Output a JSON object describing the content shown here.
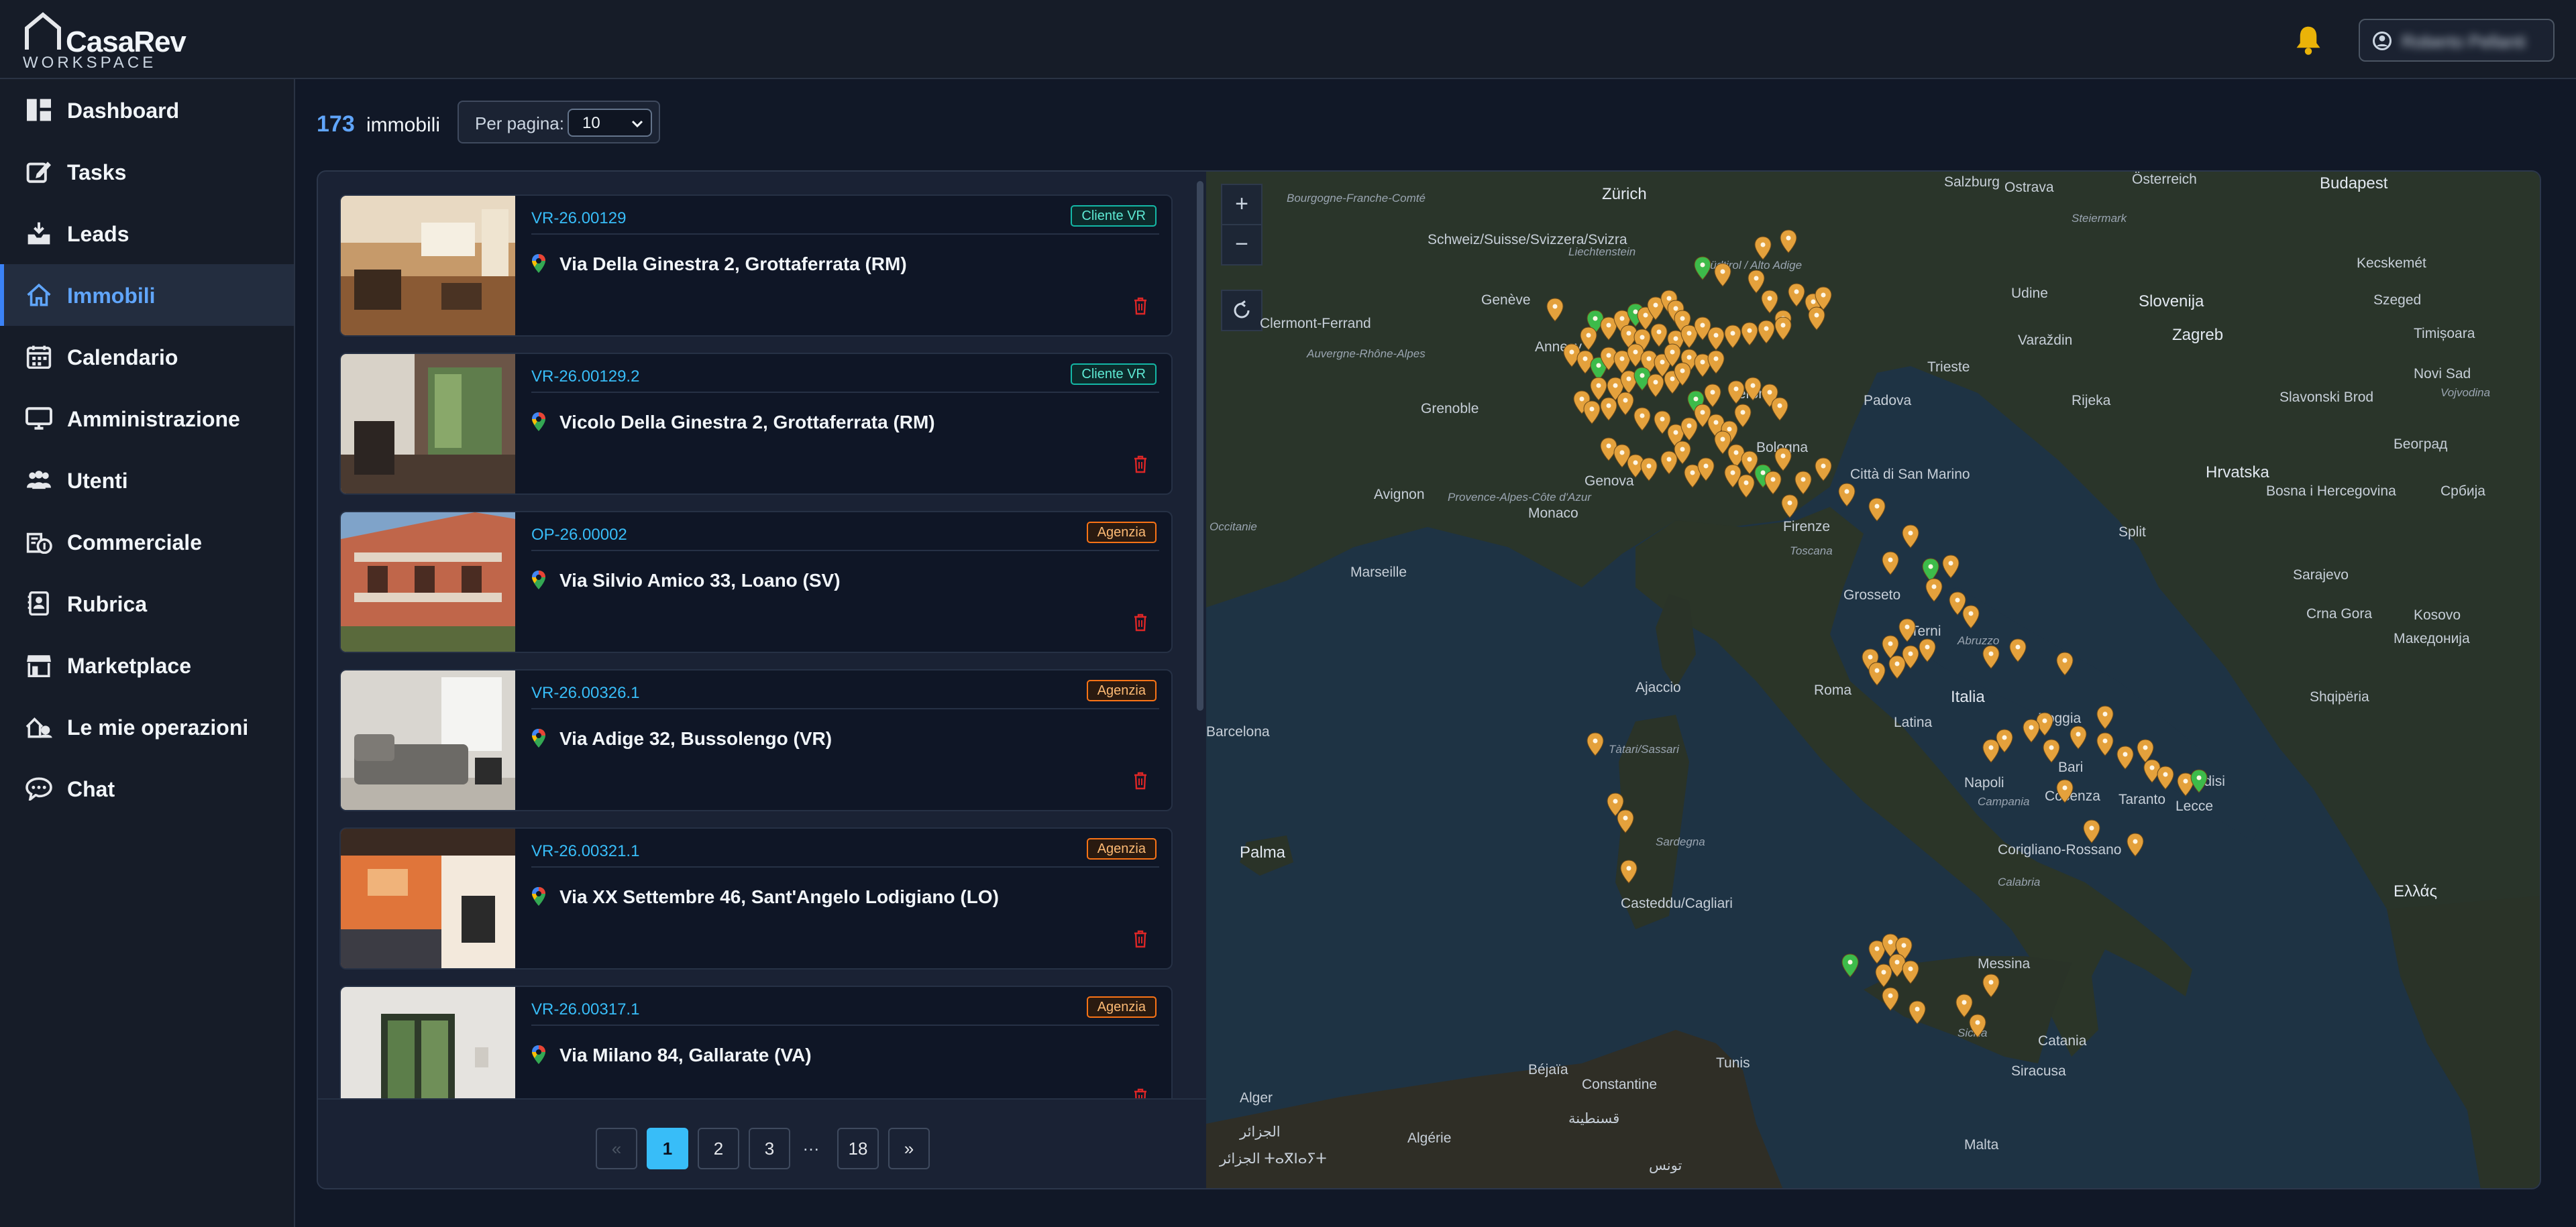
{
  "brand": {
    "name": "CasaRev",
    "sub": "WORKSPACE"
  },
  "header": {
    "user_name": "Roberto Pellanti"
  },
  "sidebar": {
    "items": [
      {
        "label": "Dashboard",
        "icon": "dashboard-icon"
      },
      {
        "label": "Tasks",
        "icon": "edit-icon"
      },
      {
        "label": "Leads",
        "icon": "inbox-download-icon"
      },
      {
        "label": "Immobili",
        "icon": "home-icon"
      },
      {
        "label": "Calendario",
        "icon": "calendar-icon"
      },
      {
        "label": "Amministrazione",
        "icon": "monitor-icon"
      },
      {
        "label": "Utenti",
        "icon": "users-icon"
      },
      {
        "label": "Commerciale",
        "icon": "commercial-icon"
      },
      {
        "label": "Rubrica",
        "icon": "address-book-icon"
      },
      {
        "label": "Marketplace",
        "icon": "store-icon"
      },
      {
        "label": "Le mie operazioni",
        "icon": "operations-icon"
      },
      {
        "label": "Chat",
        "icon": "chat-icon"
      }
    ]
  },
  "toolbar": {
    "count": "173",
    "count_label": "immobili",
    "per_page_label": "Per pagina:",
    "per_page_value": "10"
  },
  "listings": [
    {
      "code": "VR-26.00129",
      "badge": "Cliente VR",
      "address": "Via Della Ginestra 2, Grottaferrata (RM)"
    },
    {
      "code": "VR-26.00129.2",
      "badge": "Cliente VR",
      "address": "Vicolo Della Ginestra 2, Grottaferrata (RM)"
    },
    {
      "code": "OP-26.00002",
      "badge": "Agenzia",
      "address": "Via Silvio Amico 33, Loano (SV)"
    },
    {
      "code": "VR-26.00326.1",
      "badge": "Agenzia",
      "address": "Via Adige 32, Bussolengo (VR)"
    },
    {
      "code": "VR-26.00321.1",
      "badge": "Agenzia",
      "address": "Via XX Settembre 46, Sant'Angelo Lodigiano (LO)"
    },
    {
      "code": "VR-26.00317.1",
      "badge": "Agenzia",
      "address": "Via Milano 84, Gallarate (VA)"
    }
  ],
  "pagination": {
    "prev": "«",
    "pages": [
      "1",
      "2",
      "3"
    ],
    "ellipsis": "…",
    "last": "18",
    "next": "»",
    "current": "1"
  },
  "map": {
    "zoom_in": "+",
    "zoom_out": "−",
    "labels": [
      "Zürich",
      "Salzburg",
      "Österreich",
      "Budapest",
      "Bourgogne-Franche-Comté",
      "Schweiz/Suisse/Svizzera/Svizra",
      "Liechtenstein",
      "Steiermark",
      "Kecskemét",
      "Genève",
      "Südtirol / Alto Adige",
      "Udine",
      "Slovenija",
      "Szeged",
      "Timișoara",
      "Clermont-Ferrand",
      "Annecy",
      "Varaždin",
      "Zagreb",
      "Novi Sad",
      "Auvergne-Rhône-Alpes",
      "Grenoble",
      "Verona",
      "Padova",
      "Trieste",
      "Rijeka",
      "Slavonski Brod",
      "Vojvodina",
      "Београд",
      "Avignon",
      "Provence-Alpes-Côte d'Azur",
      "Genova",
      "Bologna",
      "Città di San Marino",
      "Hrvatska",
      "Bosna i Hercegovina",
      "Србија",
      "Occitanie",
      "Monaco",
      "Firenze",
      "Toscana",
      "Split",
      "Sarajevo",
      "Crna Gora",
      "Marseille",
      "Grosseto",
      "Kosovo",
      "Македонија",
      "Terni",
      "Abruzzo",
      "Ajaccio",
      "Roma",
      "Italia",
      "Foggia",
      "Shqipëria",
      "Barcelona",
      "Tàtari/Sassari",
      "Latina",
      "Bari",
      "Napoli",
      "Campania",
      "Taranto",
      "Brindisi",
      "Lecce",
      "Palma",
      "Sardegna",
      "Casteddu/Cagliari",
      "Cosenza",
      "Corigliano-Rossano",
      "Calabria",
      "Ελλάς",
      "Messina",
      "Sicilia",
      "Catania",
      "Siracusa",
      "Alger",
      "Béjaïa",
      "Constantine",
      "Tunis",
      "Malta",
      "الجزائر",
      "تونس",
      "قسنطينة",
      "الجزائر ⵜⴰⴳⵏⴰⵢⵜ",
      "Algérie",
      "Ostrava"
    ]
  },
  "colors": {
    "accent": "#38bdf8",
    "active_nav": "#60a5fa",
    "marker_orange": "#e4a13c",
    "marker_green": "#3dbb4a",
    "bell": "#eab308"
  }
}
